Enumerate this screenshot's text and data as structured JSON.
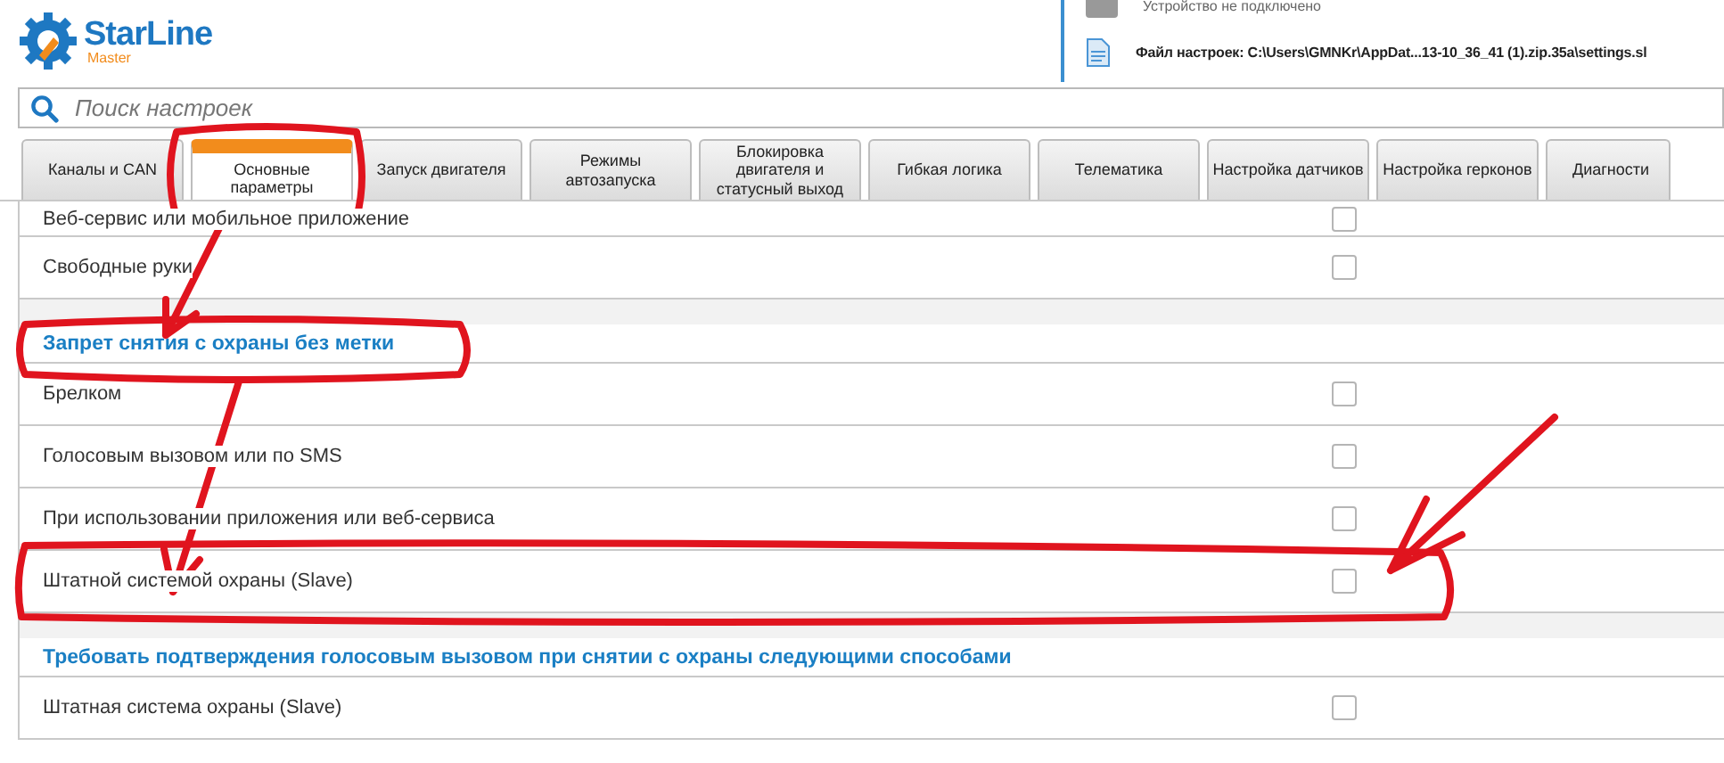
{
  "header": {
    "logo": {
      "brand": "StarLine",
      "sub": "Master"
    },
    "device_status": "Устройство не подключено",
    "settings_file": "Файл настроек: C:\\Users\\GMNKr\\AppDat...13-10_36_41 (1).zip.35a\\settings.sl"
  },
  "search": {
    "placeholder": "Поиск настроек"
  },
  "tabs": [
    {
      "label": "Каналы и CAN",
      "selected": false
    },
    {
      "label": "Основные параметры",
      "selected": true
    },
    {
      "label": "Запуск двигателя",
      "selected": false
    },
    {
      "label": "Режимы автозапуска",
      "selected": false
    },
    {
      "label": "Блокировка двигателя и статусный выход",
      "selected": false
    },
    {
      "label": "Гибкая логика",
      "selected": false
    },
    {
      "label": "Телематика",
      "selected": false
    },
    {
      "label": "Настройка датчиков",
      "selected": false
    },
    {
      "label": "Настройка герконов",
      "selected": false
    },
    {
      "label": "Диагности",
      "selected": false
    }
  ],
  "sections": [
    {
      "rows": [
        {
          "label": "Веб-сервис или мобильное приложение",
          "checked": false
        },
        {
          "label": "Свободные руки",
          "checked": false
        }
      ]
    },
    {
      "title": "Запрет снятия с охраны без метки",
      "rows": [
        {
          "label": "Брелком",
          "checked": false
        },
        {
          "label": "Голосовым вызовом или по SMS",
          "checked": false
        },
        {
          "label": "При использовании приложения или веб-сервиса",
          "checked": false
        },
        {
          "label": "Штатной системой охраны (Slave)",
          "checked": false
        }
      ]
    },
    {
      "title": "Требовать подтверждения голосовым вызовом при снятии с охраны следующими способами",
      "rows": [
        {
          "label": "Штатная система охраны (Slave)",
          "checked": false
        }
      ]
    }
  ]
}
